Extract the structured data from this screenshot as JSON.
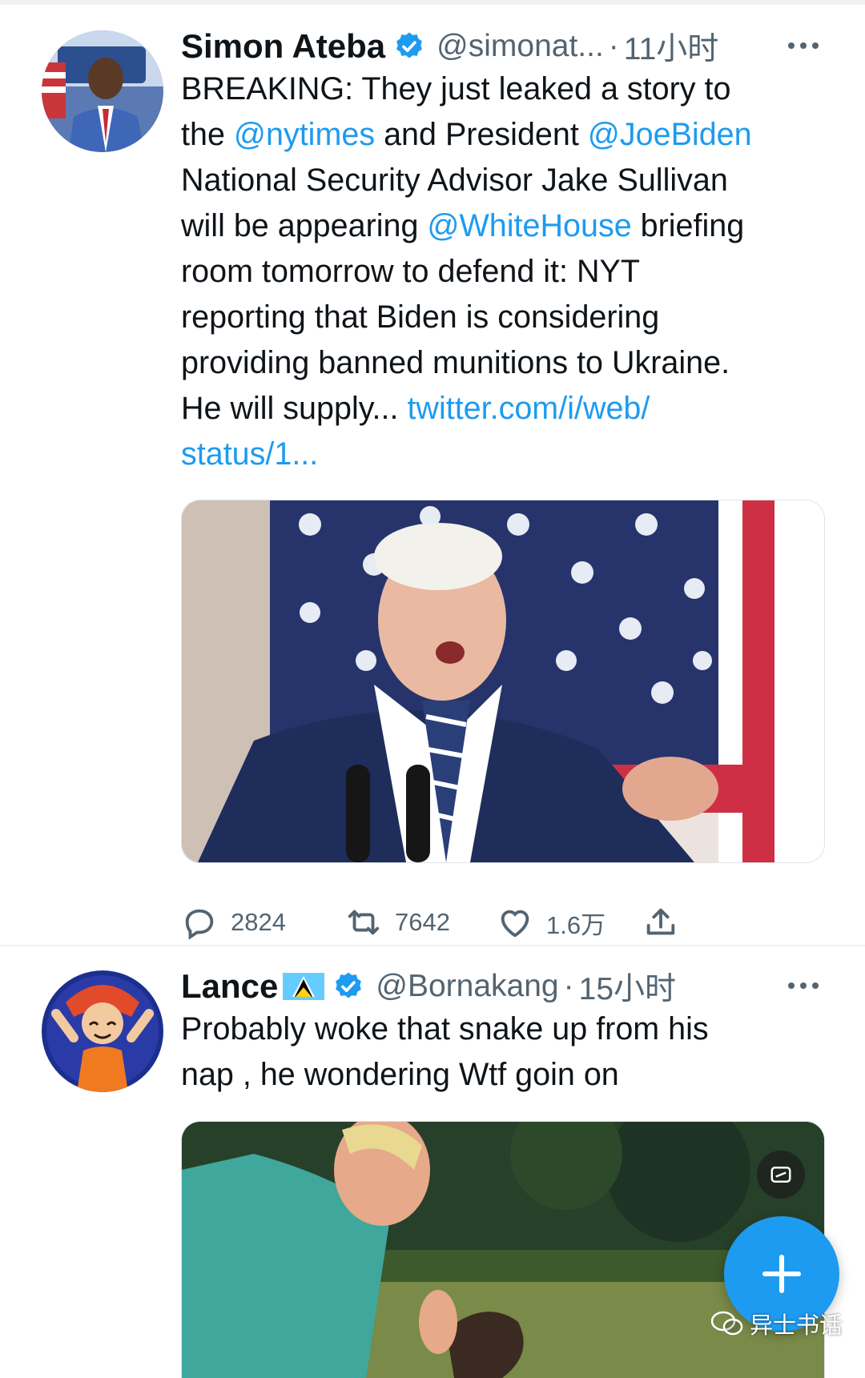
{
  "colors": {
    "link": "#1d9bf0",
    "secondary_text": "#536471",
    "verified": "#1d9bf0",
    "fab": "#1d9bf0"
  },
  "tweets": [
    {
      "name": "Simon Ateba",
      "handle": "@simonat...",
      "dot": "·",
      "time": "11小时",
      "text_lines": [
        [
          {
            "t": "BREAKING: They just leaked a story to"
          }
        ],
        [
          {
            "t": "the "
          },
          {
            "t": "@nytimes",
            "link": true
          },
          {
            "t": " and President "
          },
          {
            "t": "@JoeBiden",
            "link": true
          }
        ],
        [
          {
            "t": "National Security Advisor Jake Sullivan"
          }
        ],
        [
          {
            "t": "will be appearing "
          },
          {
            "t": "@WhiteHouse",
            "link": true
          },
          {
            "t": " briefing"
          }
        ],
        [
          {
            "t": "room tomorrow to defend it: NYT"
          }
        ],
        [
          {
            "t": "reporting that Biden is considering"
          }
        ],
        [
          {
            "t": "providing banned munitions to Ukraine."
          }
        ],
        [
          {
            "t": "He will supply... "
          },
          {
            "t": "twitter.com/i/web/",
            "link": true
          }
        ],
        [
          {
            "t": "status/1...",
            "link": true
          }
        ]
      ],
      "stats": {
        "replies": "2824",
        "retweets": "7642",
        "likes": "1.6万"
      },
      "icons": {
        "verified": "verified-badge-icon",
        "more": "more-icon",
        "reply": "reply-icon",
        "retweet": "retweet-icon",
        "like": "heart-icon",
        "share": "share-icon"
      }
    },
    {
      "name": "Lance",
      "handle": "@Bornakang",
      "dot": "·",
      "time": "15小时",
      "text_lines": [
        [
          {
            "t": "Probably woke that snake up from his"
          }
        ],
        [
          {
            "t": "nap , he wondering Wtf goin on"
          }
        ]
      ],
      "icons": {
        "flag": "saint-lucia-flag-icon",
        "verified": "verified-badge-icon",
        "more": "more-icon",
        "gif": "gif-badge-icon"
      }
    }
  ],
  "fab": {
    "icon": "compose-plus-icon"
  },
  "watermark": {
    "text": "异士书话",
    "icon": "wechat-icon"
  }
}
